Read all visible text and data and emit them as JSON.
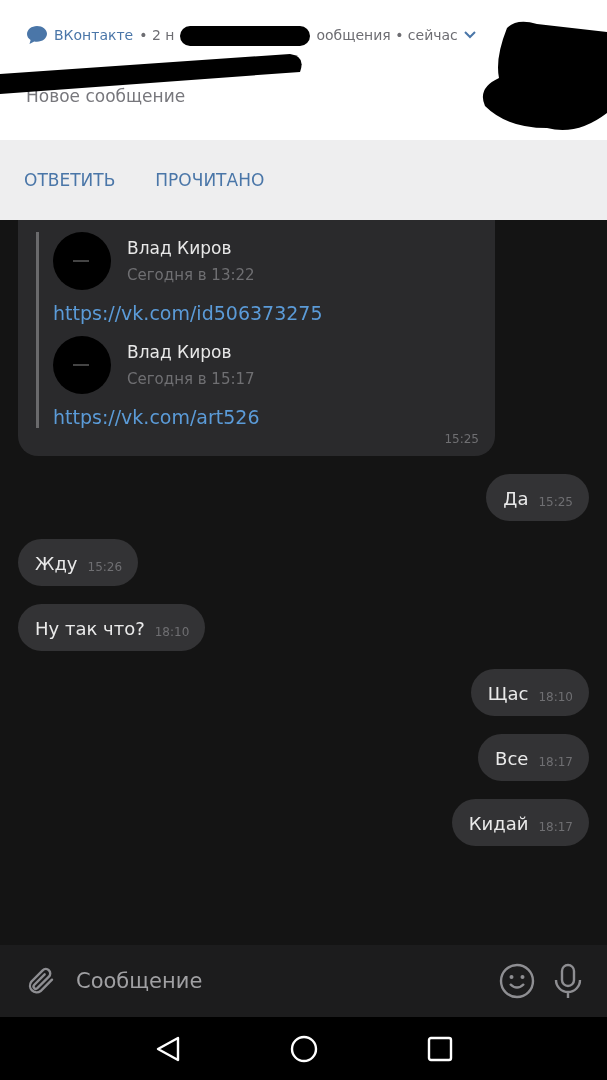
{
  "notification": {
    "app": "ВКонтакте",
    "meta_before": "• 2 н",
    "meta_after": "ообщения • сейчас",
    "text": "Новое сообщение",
    "expanded": false
  },
  "actions": [
    {
      "label": "ОТВЕТИТЬ"
    },
    {
      "label": "ПРОЧИТАНО"
    }
  ],
  "forwarded": {
    "items": [
      {
        "name": "Влад Киров",
        "date": "Сегодня в 13:22",
        "link": "https://vk.com/id506373275"
      },
      {
        "name": "Влад Киров",
        "date": "Сегодня в 15:17",
        "link": "https://vk.com/art526"
      }
    ],
    "time": "15:25"
  },
  "messages": [
    {
      "kind": "out",
      "text": "Да",
      "time": "15:25"
    },
    {
      "kind": "in",
      "text": "Жду",
      "time": "15:26"
    },
    {
      "kind": "in",
      "text": "Ну так что?",
      "time": "18:10"
    },
    {
      "kind": "out",
      "text": "Щас",
      "time": "18:10"
    },
    {
      "kind": "out",
      "text": "Все",
      "time": "18:17"
    },
    {
      "kind": "out",
      "text": "Кидай",
      "time": "18:17"
    }
  ],
  "composer": {
    "placeholder": "Сообщение"
  }
}
